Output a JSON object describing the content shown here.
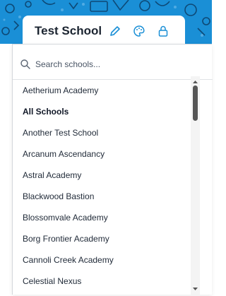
{
  "header": {
    "school_name": "Test School",
    "accent_color": "#1a8fd6",
    "icons": [
      "pencil-icon",
      "palette-icon",
      "lock-icon"
    ]
  },
  "search": {
    "placeholder": "Search schools...",
    "value": ""
  },
  "schools": [
    {
      "label": "Aetherium Academy",
      "bold": false
    },
    {
      "label": "All Schools",
      "bold": true
    },
    {
      "label": "Another Test School",
      "bold": false
    },
    {
      "label": "Arcanum Ascendancy",
      "bold": false
    },
    {
      "label": "Astral Academy",
      "bold": false
    },
    {
      "label": "Blackwood Bastion",
      "bold": false
    },
    {
      "label": "Blossomvale Academy",
      "bold": false
    },
    {
      "label": "Borg Frontier Academy",
      "bold": false
    },
    {
      "label": "Cannoli Creek Academy",
      "bold": false
    },
    {
      "label": "Celestial Nexus",
      "bold": false
    }
  ]
}
